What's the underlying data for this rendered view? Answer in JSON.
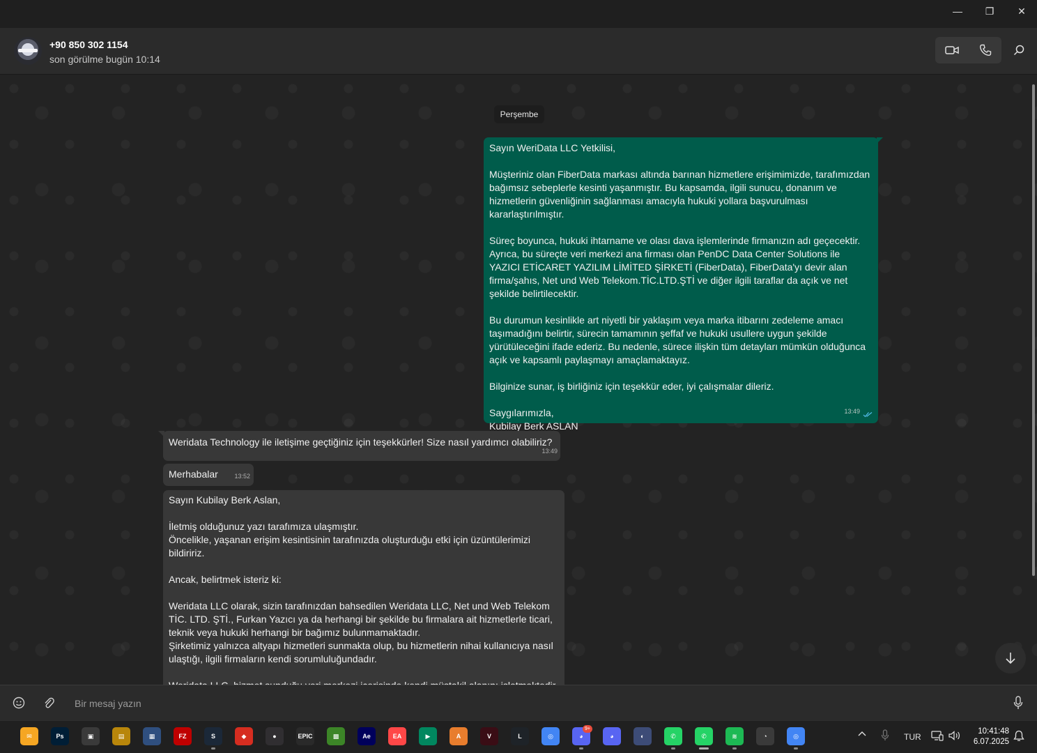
{
  "window": {
    "minimize": "—",
    "maximize": "❐",
    "close": "✕"
  },
  "header": {
    "contact_name": "+90 850 302 1154",
    "last_seen": "son görülme bugün 10:14",
    "actions": [
      "video-call-icon",
      "voice-call-icon",
      "search-icon"
    ]
  },
  "chat": {
    "date_chip": "Perşembe",
    "messages": [
      {
        "direction": "outgoing",
        "text": "Sayın WeriData LLC Yetkilisi,\n\nMüşteriniz olan FiberData markası altında barınan hizmetlere erişimimizde, tarafımızdan bağımsız sebeplerle kesinti yaşanmıştır. Bu kapsamda, ilgili sunucu, donanım ve hizmetlerin güvenliğinin sağlanması amacıyla hukuki yollara başvurulması kararlaştırılmıştır.\n\nSüreç boyunca, hukuki ihtarname ve olası dava işlemlerinde firmanızın adı geçecektir. Ayrıca, bu süreçte veri merkezi ana firması olan PenDC Data Center Solutions ile YAZICI ETİCARET YAZILIM LİMİTED ŞİRKETİ (FiberData), FiberData'yı devir alan firma/şahıs, Net und Web Telekom.TİC.LTD.ŞTİ ve diğer ilgili taraflar da açık ve net şekilde belirtilecektir.\n\nBu durumun kesinlikle art niyetli bir yaklaşım veya marka itibarını zedeleme amacı taşımadığını belirtir, sürecin tamamının şeffaf ve hukuki usullere uygun şekilde yürütüleceğini ifade ederiz. Bu nedenle, sürece ilişkin tüm detayları mümkün olduğunca açık ve kapsamlı paylaşmayı amaçlamaktayız.\n\nBilginize sunar, iş birliğiniz için teşekkür eder, iyi çalışmalar dileriz.\n\nSaygılarımızla,\nKubilay Berk ASLAN",
        "time": "13:49",
        "status": "read"
      },
      {
        "direction": "incoming",
        "text": "Weridata Technology ile iletişime geçtiğiniz için teşekkürler! Size nasıl yardımcı olabiliriz?",
        "time": "13:49"
      },
      {
        "direction": "incoming",
        "text": "Merhabalar",
        "time": "13:52"
      },
      {
        "direction": "incoming",
        "text": "Sayın Kubilay Berk Aslan,\n\nİletmiş olduğunuz yazı tarafımıza ulaşmıştır.\nÖncelikle, yaşanan erişim kesintisinin tarafınızda oluşturduğu etki için üzüntülerimizi bildiririz.\n\nAncak, belirtmek isteriz ki:\n\nWeridata LLC olarak, sizin tarafınızdan bahsedilen Weridata LLC, Net und Web Telekom TİC. LTD. ŞTİ., Furkan Yazıcı ya da herhangi bir şekilde bu firmalara ait hizmetlerle ticari, teknik veya hukuki herhangi bir bağımız bulunmamaktadır.\nŞirketimiz yalnızca altyapı hizmetleri sunmakta olup, bu hizmetlerin nihai kullanıcıya nasıl ulaştığı, ilgili firmaların kendi sorumluluğundadır.\n\nWeridata LLC, hizmet sunduğu veri merkezi içerisinde kendi müstakil alanını işletmektedir"
      }
    ]
  },
  "composer": {
    "placeholder": "Bir mesaj yazın",
    "icons": [
      "emoji-icon",
      "attach-icon",
      "microphone-icon"
    ]
  },
  "taskbar": {
    "apps": [
      {
        "name": "mail-app",
        "label": "✉",
        "color": "#f5a623"
      },
      {
        "name": "photoshop-app",
        "label": "Ps",
        "color": "#001e36"
      },
      {
        "name": "photos-app",
        "label": "▣",
        "color": "#3a3a3a"
      },
      {
        "name": "folder-app",
        "label": "▤",
        "color": "#b8860b"
      },
      {
        "name": "pc-app",
        "label": "▦",
        "color": "#2f4f7f"
      },
      {
        "name": "filezilla-app",
        "label": "FZ",
        "color": "#bf0000"
      },
      {
        "name": "steam-app",
        "label": "S",
        "color": "#1b2838"
      },
      {
        "name": "anydesk-app",
        "label": "◆",
        "color": "#d62d20"
      },
      {
        "name": "obs-app",
        "label": "●",
        "color": "#302e31"
      },
      {
        "name": "epic-games-app",
        "label": "EPIC",
        "color": "#2a2a2a"
      },
      {
        "name": "minecraft-app",
        "label": "▩",
        "color": "#3c8527"
      },
      {
        "name": "after-effects-app",
        "label": "Ae",
        "color": "#00005b"
      },
      {
        "name": "ea-app",
        "label": "EA",
        "color": "#ff4747"
      },
      {
        "name": "play-games-app",
        "label": "▶",
        "color": "#01875f"
      },
      {
        "name": "arc-app",
        "label": "A",
        "color": "#e87d2d"
      },
      {
        "name": "valorant-app",
        "label": "V",
        "color": "#3a0d15"
      },
      {
        "name": "league-app",
        "label": "L",
        "color": "#1e2328"
      },
      {
        "name": "chrome-app",
        "label": "◎",
        "color": "#4285f4"
      },
      {
        "name": "discord-app",
        "label": "◕",
        "color": "#5865f2"
      },
      {
        "name": "discord-alt-app",
        "label": "◕",
        "color": "#5865f2"
      },
      {
        "name": "sync-app",
        "label": "◐",
        "color": "#3d4c77"
      },
      {
        "name": "whatsapp-app",
        "label": "✆",
        "color": "#25d366"
      },
      {
        "name": "whatsapp-active-app",
        "label": "✆",
        "color": "#25d366"
      },
      {
        "name": "spotify-app",
        "label": "≋",
        "color": "#1db954"
      },
      {
        "name": "speedometer-app",
        "label": "◔",
        "color": "#3a3a3a"
      },
      {
        "name": "chrome-profile-app",
        "label": "◎",
        "color": "#4285f4"
      }
    ],
    "discord_badge": "9+",
    "language": "TUR",
    "time": "10:41:48",
    "date": "6.07.2025"
  }
}
